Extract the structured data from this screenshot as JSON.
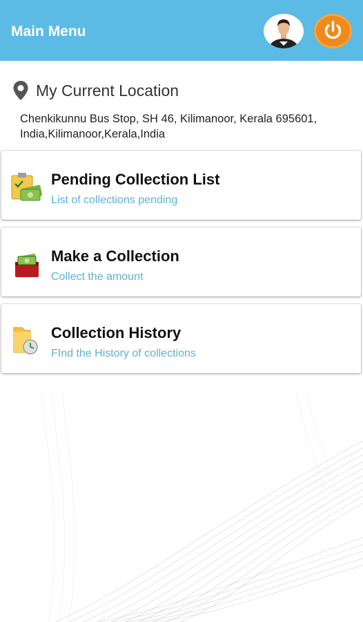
{
  "header": {
    "title": "Main Menu",
    "profile_icon": "user-avatar-icon",
    "power_icon": "power-icon"
  },
  "location": {
    "icon": "map-pin-icon",
    "title": "My Current Location",
    "address": "Chenkikunnu Bus Stop, SH 46, Kilimanoor, Kerala 695601, India,Kilimanoor,Kerala,India"
  },
  "menu": [
    {
      "icon": "clipboard-money-icon",
      "title": "Pending Collection List",
      "subtitle": "List of collections pending"
    },
    {
      "icon": "money-box-icon",
      "title": "Make a Collection",
      "subtitle": "Collect the amount"
    },
    {
      "icon": "folder-history-icon",
      "title": "Collection History",
      "subtitle": "FInd the History of collections"
    }
  ],
  "colors": {
    "appbar": "#5bbbe5",
    "power_button": "#f08a1c",
    "subtitle": "#5db0d4"
  }
}
